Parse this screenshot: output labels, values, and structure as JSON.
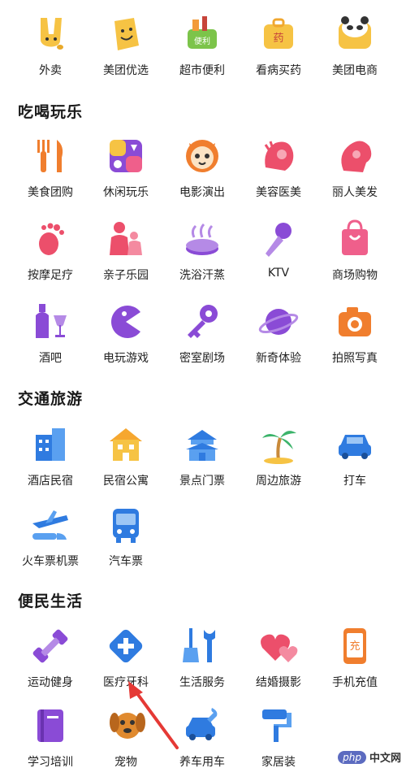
{
  "top_row": [
    {
      "label": "外卖",
      "icon": "takeout-rabbit-icon"
    },
    {
      "label": "美团优选",
      "icon": "smiley-bag-icon"
    },
    {
      "label": "超市便利",
      "icon": "grocery-basket-icon",
      "badge": "便利"
    },
    {
      "label": "看病买药",
      "icon": "medicine-box-icon",
      "badge": "药"
    },
    {
      "label": "美团电商",
      "icon": "panda-box-icon"
    }
  ],
  "sections": [
    {
      "title": "吃喝玩乐",
      "items": [
        {
          "label": "美食团购",
          "icon": "fork-knife-icon"
        },
        {
          "label": "休闲玩乐",
          "icon": "leisure-card-icon"
        },
        {
          "label": "电影演出",
          "icon": "cat-mask-icon"
        },
        {
          "label": "美容医美",
          "icon": "beauty-face-icon"
        },
        {
          "label": "丽人美发",
          "icon": "hair-salon-icon"
        },
        {
          "label": "按摩足疗",
          "icon": "footprint-icon"
        },
        {
          "label": "亲子乐园",
          "icon": "parent-child-icon"
        },
        {
          "label": "洗浴汗蒸",
          "icon": "steam-bath-icon"
        },
        {
          "label": "KTV",
          "icon": "microphone-icon"
        },
        {
          "label": "商场购物",
          "icon": "shopping-bag-icon"
        },
        {
          "label": "酒吧",
          "icon": "wine-bottle-icon"
        },
        {
          "label": "电玩游戏",
          "icon": "pacman-icon"
        },
        {
          "label": "密室剧场",
          "icon": "key-icon"
        },
        {
          "label": "新奇体验",
          "icon": "planet-icon"
        },
        {
          "label": "拍照写真",
          "icon": "camera-icon"
        }
      ]
    },
    {
      "title": "交通旅游",
      "items": [
        {
          "label": "酒店民宿",
          "icon": "hotel-building-icon"
        },
        {
          "label": "民宿公寓",
          "icon": "apartment-icon"
        },
        {
          "label": "景点门票",
          "icon": "temple-icon"
        },
        {
          "label": "周边旅游",
          "icon": "palm-tree-icon"
        },
        {
          "label": "打车",
          "icon": "car-icon"
        },
        {
          "label": "火车票机票",
          "icon": "plane-icon"
        },
        {
          "label": "汽车票",
          "icon": "bus-icon"
        }
      ]
    },
    {
      "title": "便民生活",
      "items": [
        {
          "label": "运动健身",
          "icon": "dumbbell-icon"
        },
        {
          "label": "医疗牙科",
          "icon": "medical-cross-icon"
        },
        {
          "label": "生活服务",
          "icon": "broom-wrench-icon"
        },
        {
          "label": "结婚摄影",
          "icon": "hearts-icon"
        },
        {
          "label": "手机充值",
          "icon": "phone-recharge-icon",
          "badge": "充"
        },
        {
          "label": "学习培训",
          "icon": "book-icon"
        },
        {
          "label": "宠物",
          "icon": "dog-icon"
        },
        {
          "label": "养车用车",
          "icon": "car-repair-icon"
        },
        {
          "label": "家居装",
          "icon": "paint-roller-icon"
        }
      ]
    }
  ],
  "watermark": {
    "logo": "php",
    "text": "中文网"
  },
  "colors": {
    "accent_red": "#e53935"
  }
}
